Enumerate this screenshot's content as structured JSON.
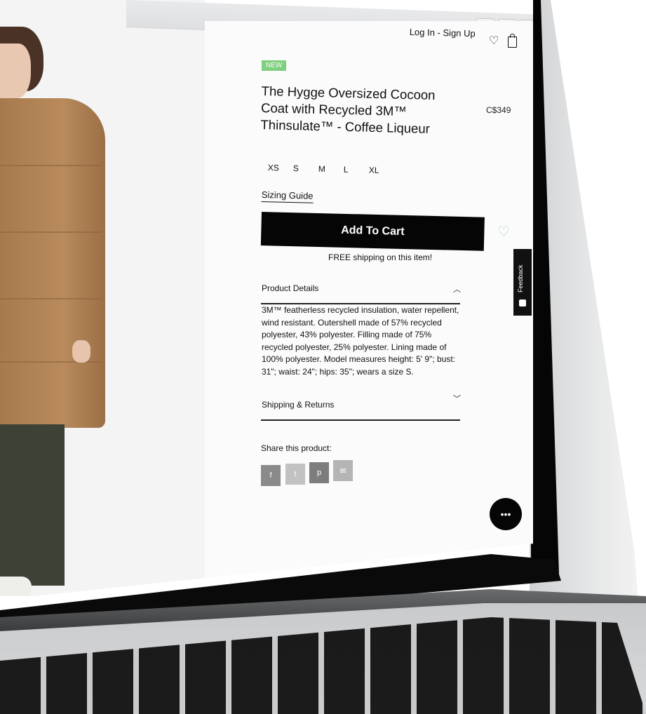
{
  "header": {
    "auth_link": "Log In - Sign Up",
    "icons": [
      "heart-icon",
      "shopping-bag-icon"
    ]
  },
  "browser": {
    "toolbar_icons": [
      "share-icon",
      "duplicate-tab-icon",
      "new-tab-icon"
    ],
    "new_tab_label": "+"
  },
  "product": {
    "badge": "NEW",
    "title": "The Hygge Oversized Cocoon Coat with Recycled 3M™ Thinsulate™ - Coffee Liqueur",
    "price": "C$349",
    "sizes": [
      "XS",
      "S",
      "M",
      "L",
      "XL"
    ],
    "sizing_guide": "Sizing Guide",
    "add_to_cart": "Add To Cart",
    "shipping_note": "FREE shipping on this item!"
  },
  "sections": {
    "details": {
      "title": "Product Details",
      "state": "expanded",
      "body": "3M™ featherless recycled insulation, water repellent, wind resistant. Outershell made of 57% recycled polyester, 43% polyester. Filling made of 75% recycled polyester, 25% polyester. Lining made of 100% polyester. Model measures height: 5' 9\"; bust: 31\"; waist: 24\"; hips: 35\"; wears a size S."
    },
    "shipping": {
      "title": "Shipping & Returns",
      "state": "collapsed"
    }
  },
  "share": {
    "label": "Share this product:",
    "buttons": [
      {
        "icon": "facebook-icon",
        "glyph": "f",
        "color": "#8a8a8a"
      },
      {
        "icon": "twitter-icon",
        "glyph": "t",
        "color": "#c2c2c2"
      },
      {
        "icon": "pinterest-icon",
        "glyph": "p",
        "color": "#7d7d7d"
      },
      {
        "icon": "email-icon",
        "glyph": "✉",
        "color": "#b5b5b5"
      }
    ]
  },
  "widgets": {
    "feedback": "Feedback",
    "chat_glyph": "•••"
  },
  "colors": {
    "badge_green": "#7ecf7e",
    "cart_button": "#050505",
    "wish_heart": "#a5d6cf"
  }
}
